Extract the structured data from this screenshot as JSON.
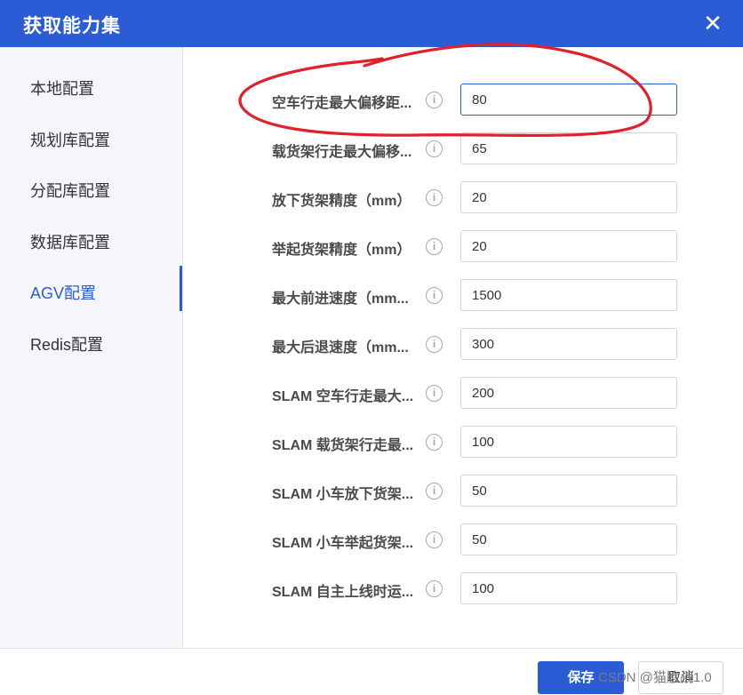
{
  "dialog": {
    "title": "获取能力集",
    "close_label": "✕"
  },
  "sidebar": {
    "items": [
      {
        "label": "本地配置"
      },
      {
        "label": "规划库配置"
      },
      {
        "label": "分配库配置"
      },
      {
        "label": "数据库配置"
      },
      {
        "label": "AGV配置",
        "active": true
      },
      {
        "label": "Redis配置"
      }
    ]
  },
  "form": {
    "rows": [
      {
        "label": "空车行走最大偏移距...",
        "value": "80"
      },
      {
        "label": "载货架行走最大偏移...",
        "value": "65"
      },
      {
        "label": "放下货架精度（mm）",
        "value": "20"
      },
      {
        "label": "举起货架精度（mm）",
        "value": "20"
      },
      {
        "label": "最大前进速度（mm...",
        "value": "1500"
      },
      {
        "label": "最大后退速度（mm...",
        "value": "300"
      },
      {
        "label": "SLAM 空车行走最大...",
        "value": "200"
      },
      {
        "label": "SLAM 载货架行走最...",
        "value": "100"
      },
      {
        "label": "SLAM 小车放下货架...",
        "value": "50"
      },
      {
        "label": "SLAM 小车举起货架...",
        "value": "50"
      },
      {
        "label": "SLAM 自主上线时运...",
        "value": "100"
      }
    ],
    "info_icon": "info-circle-icon"
  },
  "footer": {
    "save_label": "保存",
    "cancel_label": "取消"
  },
  "watermark": "CSDN @猫脸战1.0",
  "colors": {
    "accent": "#2b5cd6",
    "annotation": "#e0202a"
  }
}
